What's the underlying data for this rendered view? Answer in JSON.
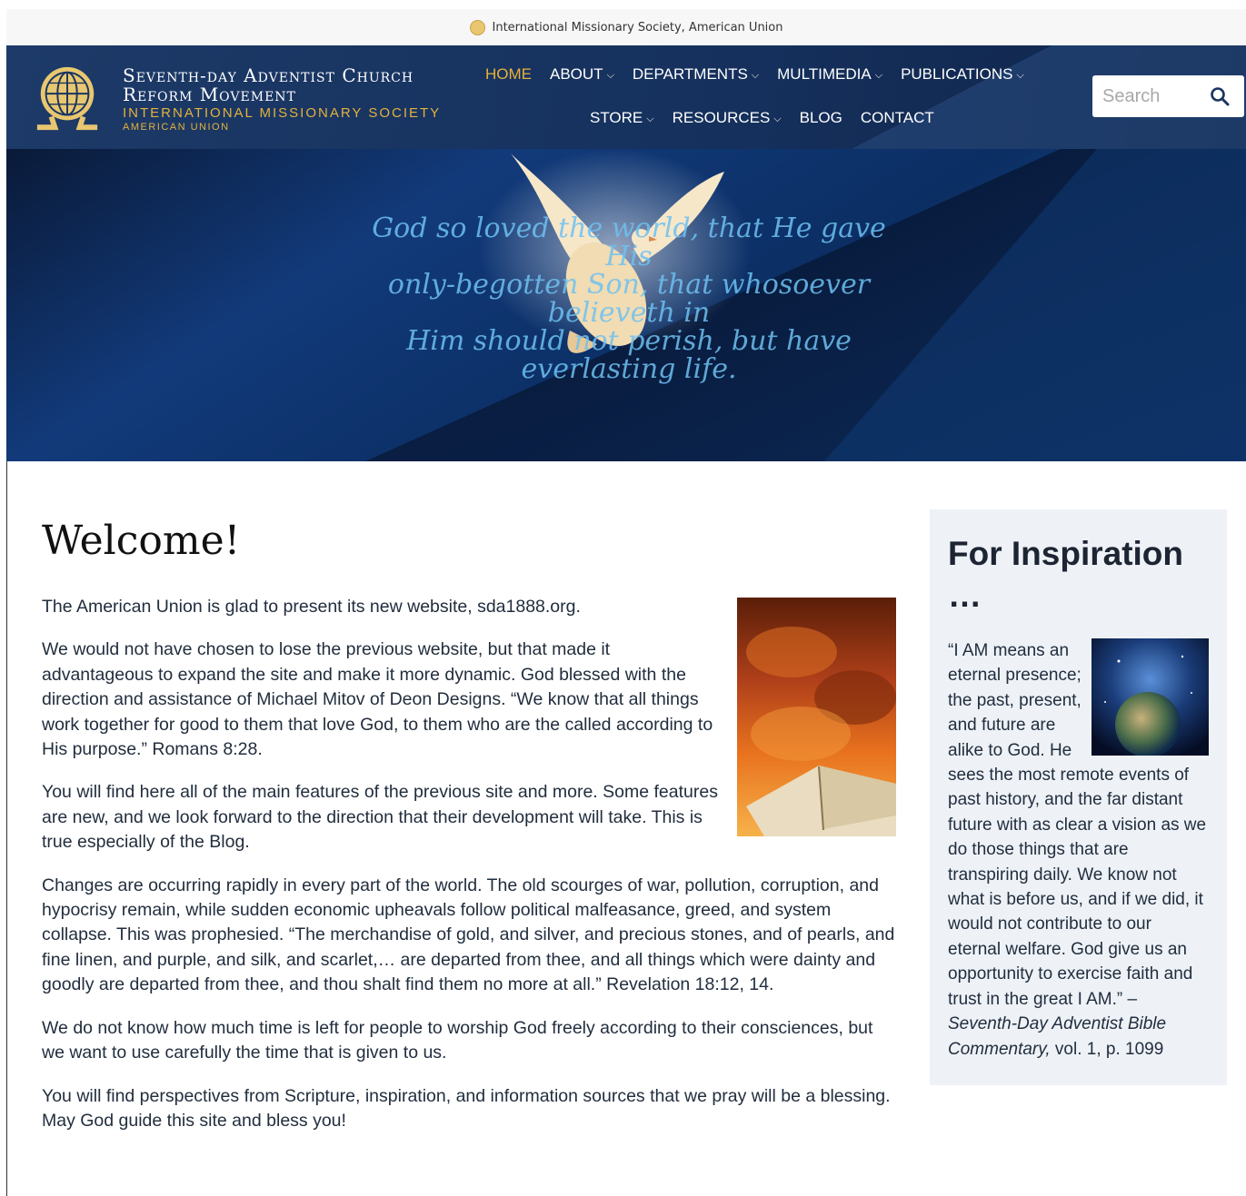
{
  "topbar": {
    "text": "International Missionary Society, American Union"
  },
  "header": {
    "org_line1": "Seventh-day Adventist Church",
    "org_line2": "Reform Movement",
    "org_line3": "INTERNATIONAL MISSIONARY SOCIETY",
    "org_line4": "AMERICAN UNION",
    "nav_row1": [
      {
        "label": "HOME",
        "active": true,
        "dropdown": false
      },
      {
        "label": "ABOUT",
        "dropdown": true
      },
      {
        "label": "DEPARTMENTS",
        "dropdown": true
      },
      {
        "label": "MULTIMEDIA",
        "dropdown": true
      },
      {
        "label": "PUBLICATIONS",
        "dropdown": true
      }
    ],
    "nav_row2": [
      {
        "label": "STORE",
        "dropdown": true
      },
      {
        "label": "RESOURCES",
        "dropdown": true
      },
      {
        "label": "BLOG",
        "dropdown": false
      },
      {
        "label": "CONTACT",
        "dropdown": false
      }
    ],
    "search": {
      "placeholder": "Search"
    }
  },
  "hero": {
    "script_line1": "God so loved the world, that He gave His",
    "script_line2": "only-begotten Son, that whosoever believeth in",
    "script_line3": "Him should not perish, but have everlasting life."
  },
  "main": {
    "title": "Welcome!",
    "paragraphs": [
      "The American Union is glad to present its new website, sda1888.org.",
      "We would not have chosen to lose the previous website, but that made it advantageous to expand the site and make it more dynamic. God blessed with the direction and assistance of Michael Mitov of Deon Designs. “We know that all things work together for good to them that love God, to them who are the called according to His purpose.” Romans 8:28.",
      "You will find here all of the main features of the previous site and more. Some features are new, and we look forward to the direction that their development will take. This is true especially of the Blog.",
      "Changes are occurring rapidly in every part of the world. The old scourges of war, pollution, corruption, and hypocrisy remain, while sudden economic upheavals follow political malfeasance, greed, and system collapse. This was prophesied. “The merchandise of gold, and silver, and precious stones, and of pearls, and fine linen, and purple, and silk, and scarlet,… are departed from thee, and all things which were dainty and goodly are departed from thee, and thou shalt find them no more at all.” Revelation 18:12, 14.",
      "We do not know how much time is left for people to worship God freely according to their consciences, but we want to use carefully the time that is given to us.",
      "You will find perspectives from Scripture, inspiration, and information sources that we pray will be a blessing. May God guide this site and bless you!"
    ]
  },
  "sidebar": {
    "title": "For Inspiration …",
    "quote": "“I AM means an eternal presence; the past, present, and future are alike to God. He sees the most remote events of past history, and the far distant future with as clear a vision as we do those things that are transpiring daily. We know not what is before us, and if we did, it would not contribute to our eternal welfare. God give us an opportunity to exercise faith and trust in the great I AM.” –",
    "cite": "Seventh-Day Adventist Bible Commentary,",
    "cite_tail": " vol. 1, p. 1099"
  },
  "colors": {
    "accent_gold": "#e8b23a",
    "header_navy": "#1a3460",
    "sidebar_bg": "#eef2f7"
  }
}
